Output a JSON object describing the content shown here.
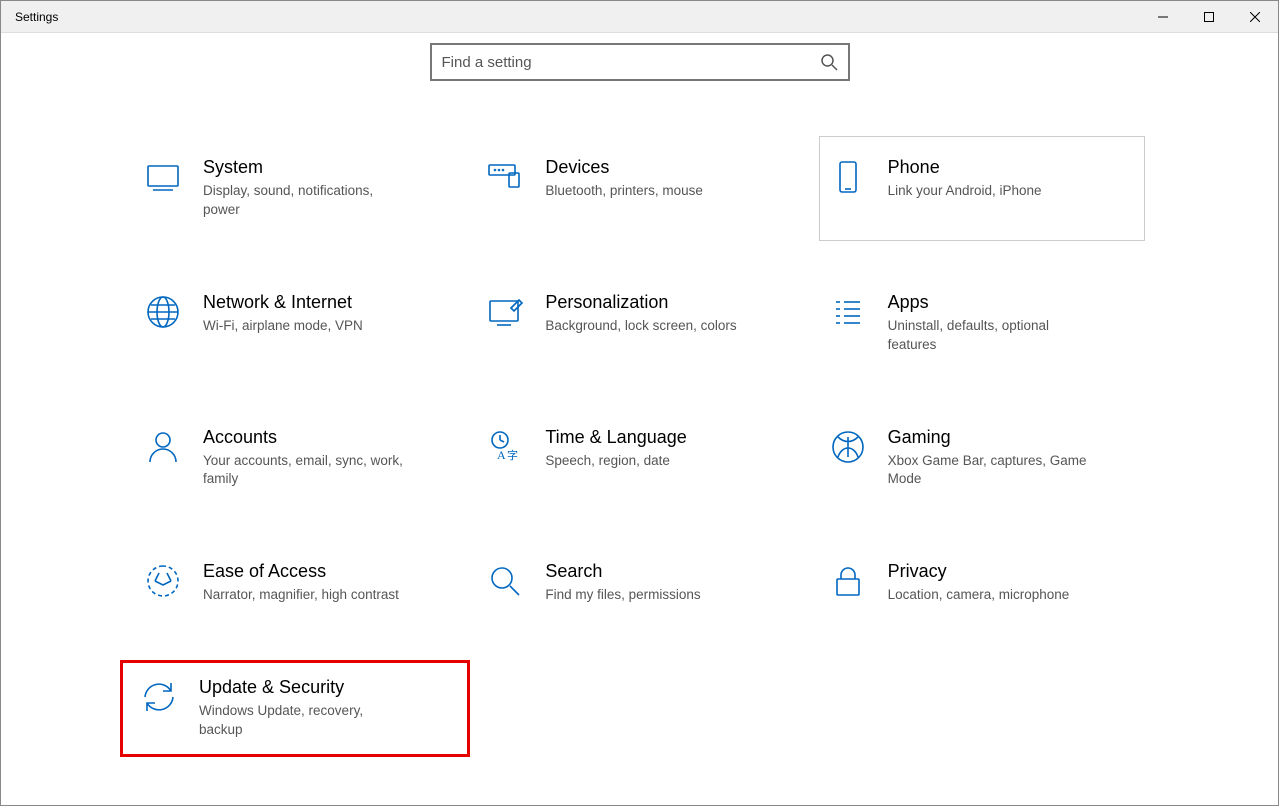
{
  "window": {
    "title": "Settings"
  },
  "search": {
    "placeholder": "Find a setting"
  },
  "tiles": {
    "system": {
      "title": "System",
      "desc": "Display, sound, notifications, power"
    },
    "devices": {
      "title": "Devices",
      "desc": "Bluetooth, printers, mouse"
    },
    "phone": {
      "title": "Phone",
      "desc": "Link your Android, iPhone"
    },
    "network": {
      "title": "Network & Internet",
      "desc": "Wi-Fi, airplane mode, VPN"
    },
    "personalization": {
      "title": "Personalization",
      "desc": "Background, lock screen, colors"
    },
    "apps": {
      "title": "Apps",
      "desc": "Uninstall, defaults, optional features"
    },
    "accounts": {
      "title": "Accounts",
      "desc": "Your accounts, email, sync, work, family"
    },
    "time": {
      "title": "Time & Language",
      "desc": "Speech, region, date"
    },
    "gaming": {
      "title": "Gaming",
      "desc": "Xbox Game Bar, captures, Game Mode"
    },
    "ease": {
      "title": "Ease of Access",
      "desc": "Narrator, magnifier, high contrast"
    },
    "searchtile": {
      "title": "Search",
      "desc": "Find my files, permissions"
    },
    "privacy": {
      "title": "Privacy",
      "desc": "Location, camera, microphone"
    },
    "update": {
      "title": "Update & Security",
      "desc": "Windows Update, recovery, backup"
    }
  }
}
